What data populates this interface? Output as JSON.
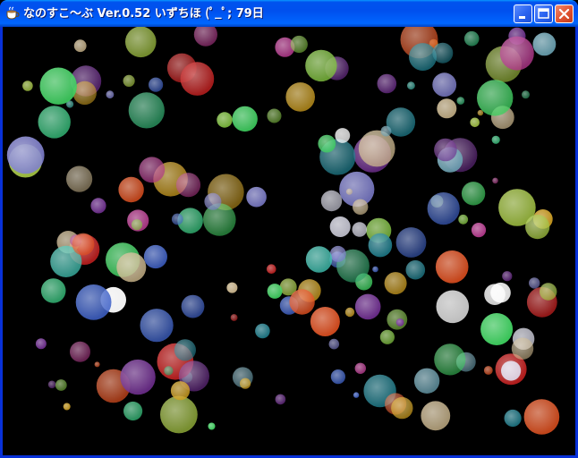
{
  "window": {
    "title": "なのすこ〜ぶ Ver.0.52  いずちほ  (ﾟ_ﾟ;  79日",
    "app_icon": "teacup-icon",
    "controls": {
      "minimize_icon": "minimize-icon",
      "maximize_icon": "maximize-icon",
      "close_icon": "close-icon"
    }
  },
  "canvas": {
    "background_color": "#000000",
    "particle_colors": [
      "#7fbf3f",
      "#b0388a",
      "#6aa0b0",
      "#c9b48a",
      "#3f62c8",
      "#e0e0f0",
      "#2fa56a",
      "#d0a020",
      "#c02020",
      "#3fd060",
      "#20808f",
      "#6f2f8f",
      "#e05020",
      "#a0c040",
      "#40c0b0",
      "#8080d0",
      "#ffffff"
    ]
  }
}
